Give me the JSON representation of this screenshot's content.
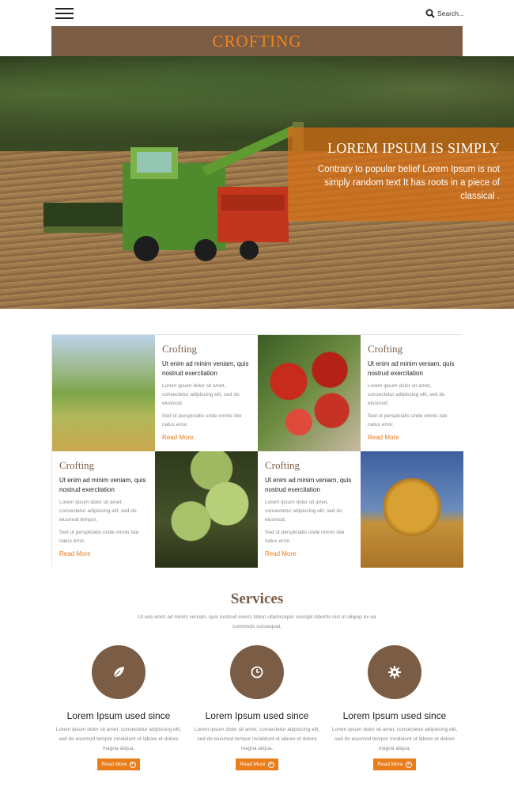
{
  "header": {
    "search_placeholder": "Search...",
    "logo": "CROFTING"
  },
  "hero": {
    "title": "LOREM IPSUM IS SIMPLY",
    "text": "Contrary to popular belief Lorem Ipsum is not simply random text It has roots in a piece of classical ."
  },
  "cards": [
    {
      "title": "Crofting",
      "lead": "Ut enim ad minim veniam, quis nostrud exercitation",
      "body1": "Lorem ipsum dolor sit amet, consectetur adipiscing elit, sed do eiusmod.",
      "body2": "Sed ut perspiciatis unde omnis iste natus error.",
      "more": "Read More"
    },
    {
      "title": "Crofting",
      "lead": "Ut enim ad minim veniam, quis nostrud exercitation",
      "body1": "Lorem ipsum dolor sit amet, consectetur adipiscing elit, sed do eiusmod.",
      "body2": "Sed ut perspiciatis unde omnis iste natus error.",
      "more": "Read More"
    },
    {
      "title": "Crofting",
      "lead": "Ut enim ad minim veniam, quis nostrud exercitation",
      "body1": "Lorem ipsum dolor sit amet, consectetur adipiscing elit, sed do eiusmod tempor.",
      "body2": "Sed ut perspiciatis unde omnis iste natus error.",
      "more": "Read More"
    },
    {
      "title": "Crofting",
      "lead": "Ut enim ad minim veniam, quis nostrud exercitation",
      "body1": "Lorem ipsum dolor sit amet, consectetur adipiscing elit, sed do eiusmod.",
      "body2": "Sed ut perspiciatis unde omnis iste natus error.",
      "more": "Read More"
    }
  ],
  "services": {
    "title": "Services",
    "subtitle": "Ut wisi enim ad minim veniam, quis nostrud exerci tation ullamcorper suscipit lobortis nisl ut aliquip ex ea commodo consequat.",
    "items": [
      {
        "icon": "leaf-icon",
        "title": "Lorem Ipsum used since",
        "text": "Lorem ipsum dolor sit amet, consectetur adipiscing elit, sed do eiusmod tempor incididunt ut labore et dolore magna aliqua.",
        "button": "Read More"
      },
      {
        "icon": "clock-icon",
        "title": "Lorem Ipsum used since",
        "text": "Lorem ipsum dolor sit amet, consectetur adipiscing elit, sed do eiusmod tempor incididunt ut labore et dolore magna aliqua.",
        "button": "Read More"
      },
      {
        "icon": "gear-icon",
        "title": "Lorem Ipsum used since",
        "text": "Lorem ipsum dolor sit amet, consectetur adipiscing elit, sed do eiusmod tempor incididunt ut labore et dolore magna aliqua.",
        "button": "Read More"
      }
    ]
  },
  "colors": {
    "brand_brown": "#7b5c45",
    "accent_orange": "#e97d1a"
  }
}
